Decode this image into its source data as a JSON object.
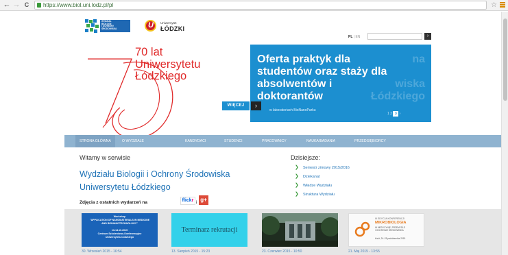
{
  "browser": {
    "url": "https://www.biol.uni.lodz.pl/pl",
    "back_glyph": "←",
    "forward_glyph": "→",
    "reload_glyph": "C",
    "bookmark_glyph": "☆"
  },
  "header": {
    "faculty_logo_lines": [
      "WYDZIAŁ",
      "BIOLOGII",
      "I OCHRONY",
      "ŚRODOWISKA"
    ],
    "uni_small": "Uniwersytet",
    "uni_big": "ŁÓDZKI",
    "uni_emblem_letter": "U",
    "lang_active": "PL",
    "lang_sep": " | ",
    "lang_other": "EN",
    "search_value": "",
    "search_button": "›"
  },
  "anniversary": {
    "title": "70 lat\nUniwersytetu\nŁódzkiego"
  },
  "banner": {
    "text": "Oferta praktyk dla\nstudentów oraz staży dla\nabsolwentów i\ndoktorantów",
    "ghost_text": "na\n\nwiska\nŁódzkiego",
    "subtext": "w laboratoriach BioNanoParku",
    "more_label": "WIĘCEJ",
    "more_arrow": "›",
    "pager": {
      "before": "1  2",
      "active": "3",
      "after": "›"
    }
  },
  "main_nav": [
    "Strona główna",
    "O wydziale",
    "Kandydaci",
    "Studenci",
    "Pracownicy",
    "Nauka/badania",
    "Przedsiębiorcy"
  ],
  "welcome": {
    "small": "Witamy w serwisie",
    "big": "Wydziału Biologii i Ochrony Środowiska\nUniwersytetu Łódzkiego",
    "photos_label": "Zdjęcia z ostatnich wydarzeń na",
    "flickr_blue": "flick",
    "flickr_pink": "r",
    "flickr_sep": "i",
    "gplus": "g+"
  },
  "today": {
    "heading": "Dzisiejsze:",
    "items": [
      "Semestr zimowy 2015/2016",
      "Dziekanat",
      "Władze Wydziału",
      "Struktura Wydziału"
    ],
    "chevron": "❯"
  },
  "gallery": {
    "items": [
      {
        "image_text": "Workshop\n\"APPLICATION OF NANOMATERIALS IN MEDICINE\nAND BIONANOTECHNOLOGY\"\n\n13-14.10.2015\nCentrum Szkoleniowo-Konferencyjne\nUniwersytetu Łódzkiego",
        "date": "30. Wrzesień 2015 - 16:54"
      },
      {
        "image_text": "Terminarz rekrutacji",
        "date": "13. Sierpień 2015 - 15:23"
      },
      {
        "image_text": "",
        "date": "23. Czerwiec 2015 - 10:50"
      },
      {
        "image_small": "III EDYCJA KONFERENCJI",
        "image_big": "MIKROBIOLOGIA",
        "image_sub": "W MEDYCYNIE, PRZEMYŚLE\nI OCHRONIE ŚRODOWISKA",
        "image_date": "Łódź, 24–25 października 2015",
        "date": "21. Maj 2015 - 13:55"
      }
    ]
  },
  "colors": {
    "accent_blue": "#1c8fd0",
    "nav_blue": "#8fb3d0",
    "anniversary_red": "#e02a2a",
    "link_blue": "#1f73b7",
    "check_green": "#3a9a3a"
  }
}
